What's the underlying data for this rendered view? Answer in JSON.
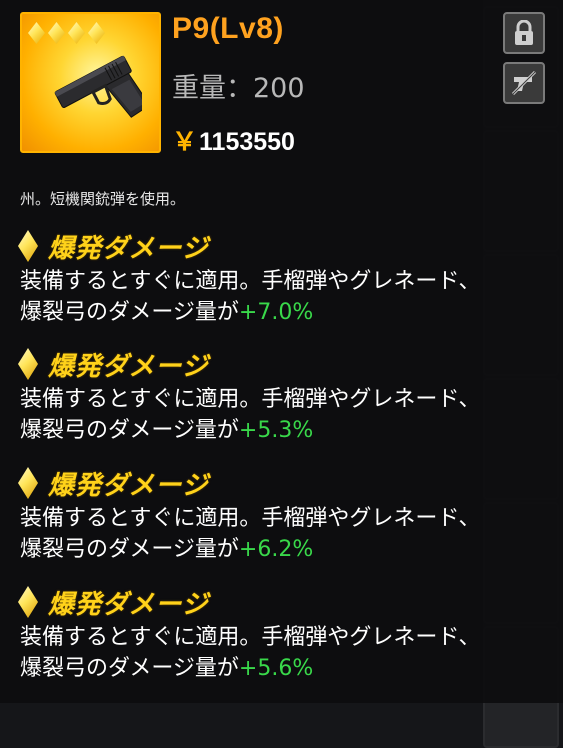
{
  "item": {
    "name": "P9(Lv8)",
    "weight_label": "重量：",
    "weight_value": "200",
    "currency_symbol": "￥",
    "price": "1153550",
    "rarity_stars": 4,
    "icon": "pistol-icon"
  },
  "buttons": {
    "lock_icon": "lock-icon",
    "discard_icon": "no-weapon-icon"
  },
  "description": "州。短機関銃弾を使用。",
  "stats": [
    {
      "name": "爆発ダメージ",
      "line1": "装備するとすぐに適用。手榴弾やグレネード、",
      "line2": "爆裂弓のダメージ量が",
      "value": "+7.0%"
    },
    {
      "name": "爆発ダメージ",
      "line1": "装備するとすぐに適用。手榴弾やグレネード、",
      "line2": "爆裂弓のダメージ量が",
      "value": "+5.3%"
    },
    {
      "name": "爆発ダメージ",
      "line1": "装備するとすぐに適用。手榴弾やグレネード、",
      "line2": "爆裂弓のダメージ量が",
      "value": "+6.2%"
    },
    {
      "name": "爆発ダメージ",
      "line1": "装備するとすぐに適用。手榴弾やグレネード、",
      "line2": "爆裂弓のダメージ量が",
      "value": "+5.6%"
    }
  ],
  "colors": {
    "name": "#ffa21f",
    "stat_title": "#ffd21a",
    "stat_value": "#39d84a"
  }
}
